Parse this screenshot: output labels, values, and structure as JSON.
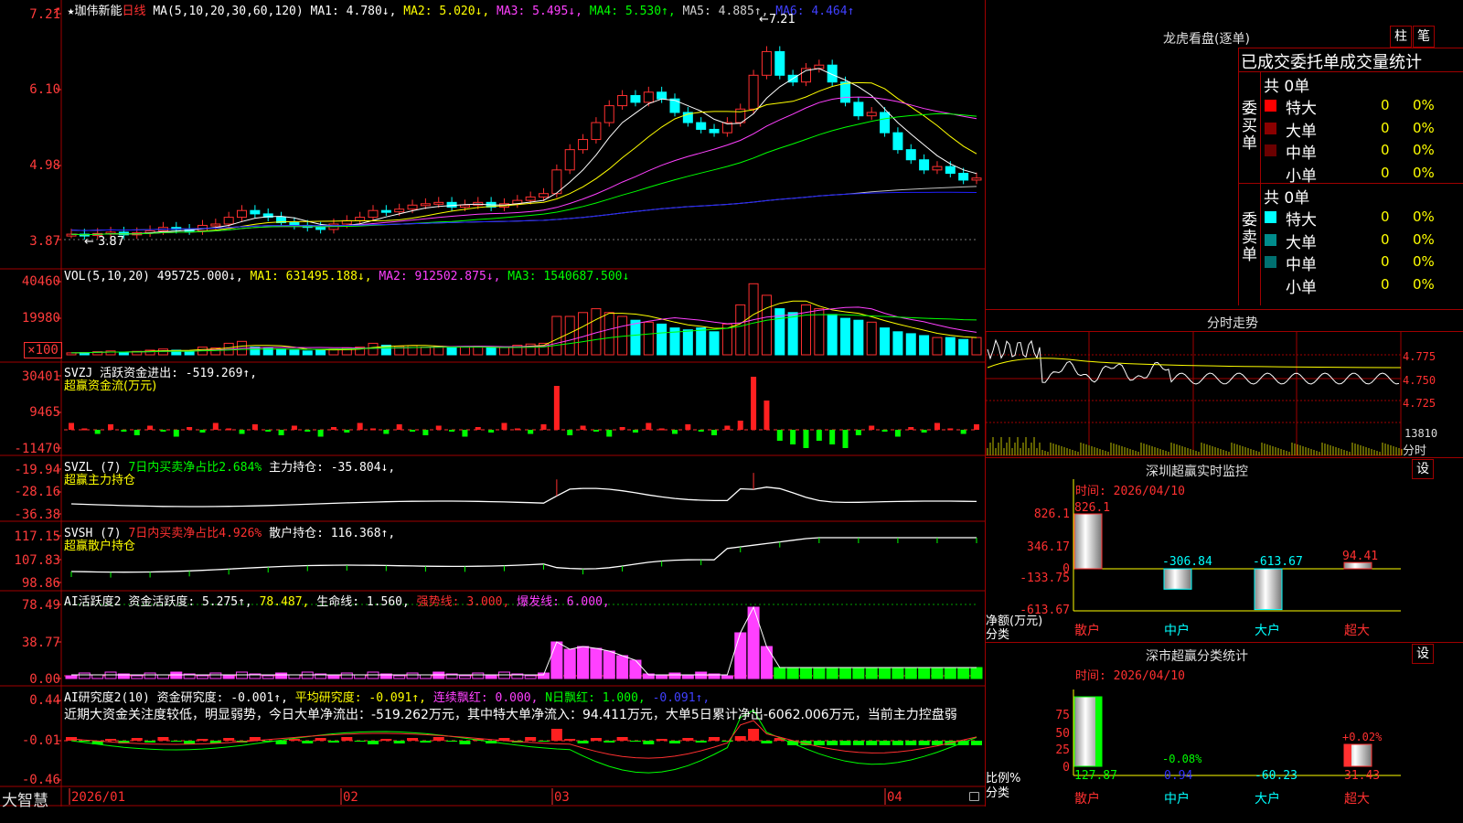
{
  "stock": {
    "name": "★珈伟新能",
    "period": "日线",
    "cycle_icon": "settings-arrow"
  },
  "ma_line": {
    "params": "MA(5,10,20,30,60,120)",
    "ma1": "MA1: 4.780↓,",
    "ma2": "MA2: 5.020↓,",
    "ma3": "MA3: 5.495↓,",
    "ma4": "MA4: 5.530↑,",
    "ma5": "MA5: 4.885↑,",
    "ma6": "MA6: 4.464↑"
  },
  "price_axis": [
    "7.21",
    "6.10",
    "4.98",
    "3.87"
  ],
  "price_marks": {
    "high": "7.21",
    "low": "3.87"
  },
  "vol": {
    "title": "VOL(5,10,20)",
    "value": "495725.000↓,",
    "ma1": "MA1: 631495.188↓,",
    "ma2": "MA2: 912502.875↓,",
    "ma3": "MA3: 1540687.500↓",
    "axis": [
      "40460",
      "19980",
      "×100"
    ]
  },
  "svzj": {
    "title": "SVZJ",
    "line1": "活跃资金进出: -519.269↑,",
    "line2": "超赢资金流(万元)",
    "axis": [
      "30401",
      "9465",
      "-11470"
    ]
  },
  "svzl": {
    "title": "SVZL (7)",
    "ratio": "7日内买卖净占比2.684%",
    "hold": "主力持仓: -35.804↓,",
    "line2": "超赢主力持仓",
    "axis": [
      "-19.94",
      "-28.16",
      "-36.38"
    ]
  },
  "svsh": {
    "title": "SVSH (7)",
    "ratio": "7日内买卖净占比4.926%",
    "hold": "散户持仓: 116.368↑,",
    "line2": "超赢散户持仓",
    "axis": [
      "117.15",
      "107.83",
      "98.86"
    ]
  },
  "ai_active": {
    "title": "AI活跃度2",
    "act": "资金活跃度: 5.275↑,",
    "v2": "78.487,",
    "life": "生命线: 1.560,",
    "strong": "强势线: 3.000,",
    "burst": "爆发线: 6.000,",
    "axis": [
      "78.49",
      "38.77",
      "0.00"
    ]
  },
  "ai_research": {
    "title": "AI研究度2(10)",
    "fund": "资金研究度: -0.001↑,",
    "avg": "平均研究度: -0.091↑,",
    "lianxu": "连续飘红: 0.000,",
    "nri": "N日飘红: 1.000,",
    "last": "-0.091↑,",
    "comment": "近期大资金关注度较低，明显弱势，今日大单净流出：-519.262万元，其中特大单净流入：94.411万元，大单5日累计净出-6062.006万元，当前主力控盘弱",
    "axis": [
      "0.44",
      "-0.01",
      "-0.46"
    ]
  },
  "x_axis": {
    "logo": "大智慧",
    "labels": [
      "2026/01",
      "02",
      "03",
      "04"
    ]
  },
  "right_panel": {
    "title": "龙虎看盘(逐单)",
    "btn_zhu": "柱",
    "btn_bi": "笔",
    "header": "已成交委托单成交量统计",
    "buy": {
      "side": "委买单",
      "total": "共 0单",
      "rows": [
        {
          "label": "特大",
          "count": "0",
          "pct": "0%",
          "color": "#ff0000"
        },
        {
          "label": "大单",
          "count": "0",
          "pct": "0%",
          "color": "#8b0000"
        },
        {
          "label": "中单",
          "count": "0",
          "pct": "0%",
          "color": "#6b0000"
        },
        {
          "label": "小单",
          "count": "0",
          "pct": "0%",
          "color": "#000000"
        }
      ]
    },
    "sell": {
      "side": "委卖单",
      "total": "共 0单",
      "rows": [
        {
          "label": "特大",
          "count": "0",
          "pct": "0%",
          "color": "#00ffff"
        },
        {
          "label": "大单",
          "count": "0",
          "pct": "0%",
          "color": "#008b8b"
        },
        {
          "label": "中单",
          "count": "0",
          "pct": "0%",
          "color": "#007070"
        },
        {
          "label": "小单",
          "count": "0",
          "pct": "0%",
          "color": "#000000"
        }
      ]
    }
  },
  "intraday": {
    "title": "分时走势",
    "axis": [
      "4.775",
      "4.750",
      "4.725"
    ],
    "vol_label": "13810",
    "sub_label": "分时"
  },
  "sz_monitor": {
    "title": "深圳超赢实时监控",
    "btn": "设",
    "time": "时间: 2026/04/10",
    "axis": [
      "826.1",
      "346.17",
      "0",
      "-133.75",
      "-613.67"
    ],
    "ylabel": "净额(万元)",
    "xcat": "分类",
    "bars": [
      {
        "cat": "散户",
        "value": "826.1"
      },
      {
        "cat": "中户",
        "value": "-306.84"
      },
      {
        "cat": "大户",
        "value": "-613.67"
      },
      {
        "cat": "超大",
        "value": "94.41"
      }
    ]
  },
  "sz_class": {
    "title": "深市超赢分类统计",
    "btn": "设",
    "time": "时间: 2026/04/10",
    "axis": [
      "75",
      "50",
      "25",
      "0"
    ],
    "ylabel": "比例%",
    "xcat": "分类",
    "bars": [
      {
        "cat": "散户",
        "value": "127.87",
        "top": ""
      },
      {
        "cat": "中户",
        "value": "0.94",
        "top": "-0.08%"
      },
      {
        "cat": "大户",
        "value": "-60.23",
        "top": ""
      },
      {
        "cat": "超大",
        "value": "31.43",
        "top": "+0.02%"
      }
    ]
  }
}
